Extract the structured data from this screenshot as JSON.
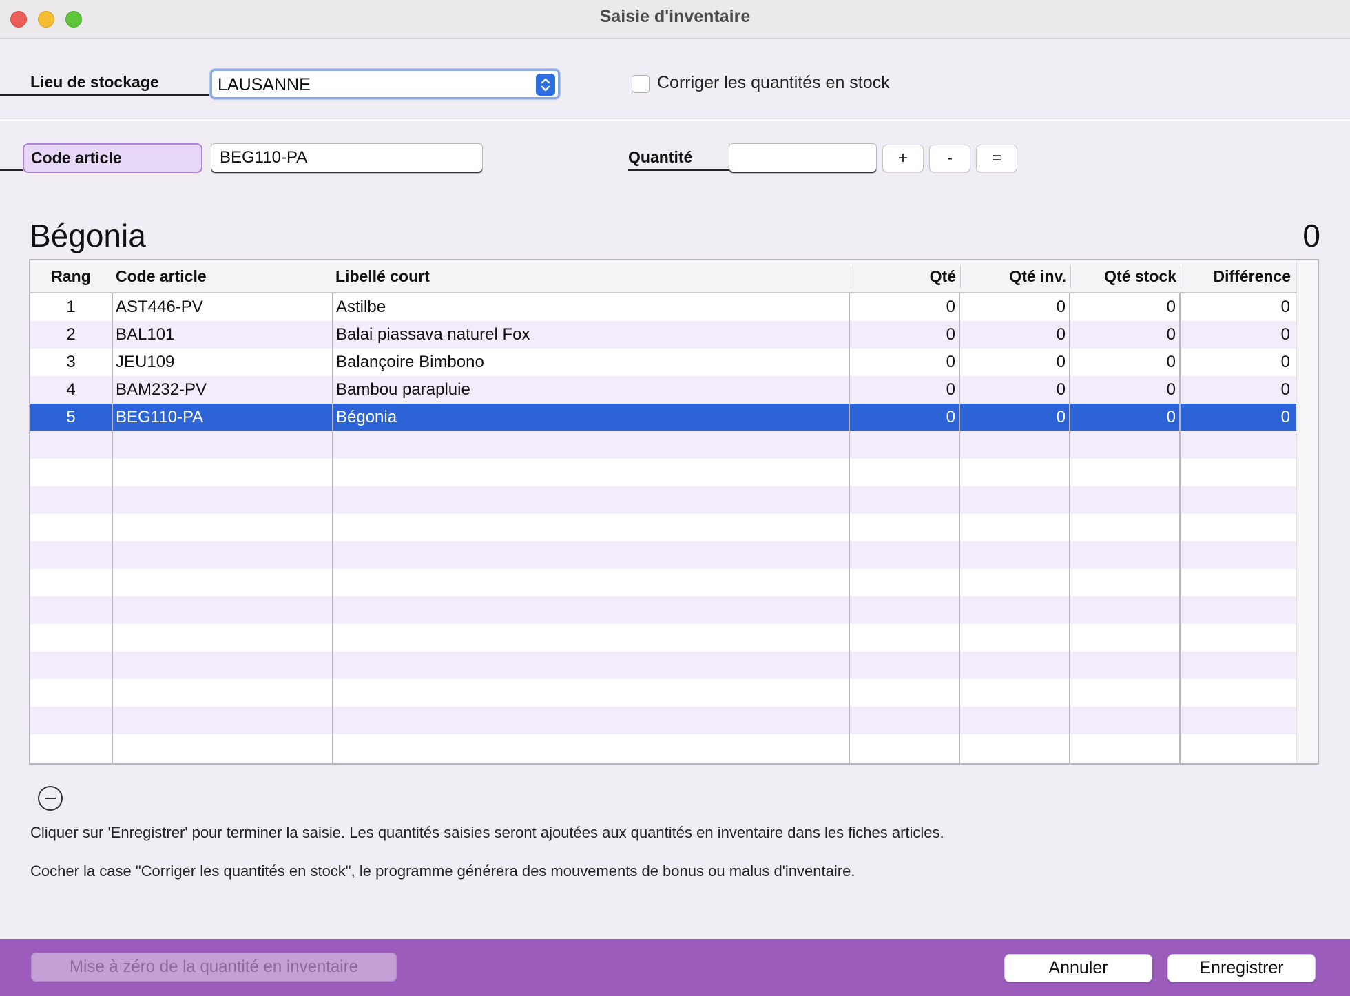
{
  "window": {
    "title": "Saisie d'inventaire"
  },
  "storage": {
    "label": "Lieu de stockage",
    "value": "LAUSANNE"
  },
  "correct_stock": {
    "label": "Corriger les quantités en stock",
    "checked": false
  },
  "article": {
    "label": "Code article",
    "value": "BEG110-PA"
  },
  "quantity": {
    "label": "Quantité",
    "value": "",
    "plus": "+",
    "minus": "-",
    "equals": "="
  },
  "current_item": {
    "name": "Bégonia",
    "count": "0"
  },
  "table": {
    "columns": [
      "Rang",
      "Code article",
      "Libellé court",
      "Qté",
      "Qté inv.",
      "Qté stock",
      "Différence"
    ],
    "rows": [
      [
        "1",
        "AST446-PV",
        "Astilbe",
        "0",
        "0",
        "0",
        "0"
      ],
      [
        "2",
        "BAL101",
        "Balai piassava naturel Fox",
        "0",
        "0",
        "0",
        "0"
      ],
      [
        "3",
        "JEU109",
        "Balançoire Bimbono",
        "0",
        "0",
        "0",
        "0"
      ],
      [
        "4",
        "BAM232-PV",
        "Bambou parapluie",
        "0",
        "0",
        "0",
        "0"
      ],
      [
        "5",
        "BEG110-PA",
        "Bégonia",
        "0",
        "0",
        "0",
        "0"
      ]
    ],
    "selected_row": 4
  },
  "info": {
    "line1": "Cliquer sur 'Enregistrer' pour terminer la saisie. Les quantités saisies seront ajoutées aux quantités en inventaire dans les fiches articles.",
    "line2": "Cocher la case \"Corriger les quantités en stock\", le programme générera des mouvements de bonus ou malus d'inventaire."
  },
  "footer": {
    "reset_label": "Mise à zéro de la quantité en inventaire",
    "cancel_label": "Annuler",
    "save_label": "Enregistrer"
  },
  "colors": {
    "accent": "#2c63d6",
    "footer": "#9a5bbb",
    "row_alt": "#f3ecfb"
  }
}
